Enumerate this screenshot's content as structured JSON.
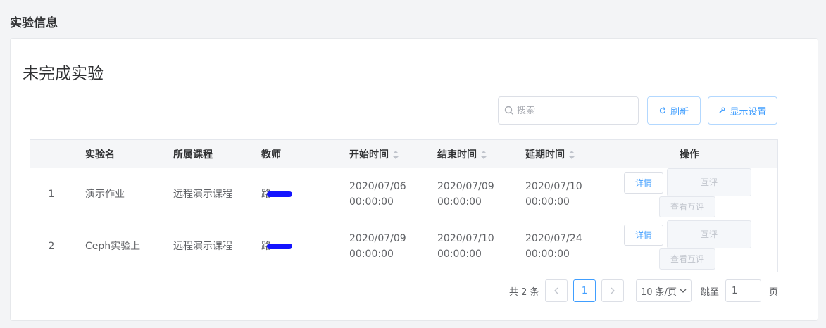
{
  "header": {
    "section_title": "实验信息"
  },
  "card": {
    "title": "未完成实验"
  },
  "toolbar": {
    "search_placeholder": "搜索",
    "refresh_label": "刷新",
    "settings_label": "显示设置"
  },
  "table": {
    "columns": [
      "",
      "实验名",
      "所属课程",
      "教师",
      "开始时间",
      "结束时间",
      "延期时间",
      "操作"
    ],
    "rows": [
      {
        "idx": "1",
        "name": "演示作业",
        "course": "远程演示课程",
        "teacher": "路",
        "start": "2020/07/06 00:00:00",
        "end": "2020/07/09 00:00:00",
        "delay": "2020/07/10 00:00:00"
      },
      {
        "idx": "2",
        "name": "Ceph实验上",
        "course": "远程演示课程",
        "teacher": "路",
        "start": "2020/07/09 00:00:00",
        "end": "2020/07/10 00:00:00",
        "delay": "2020/07/24 00:00:00"
      }
    ],
    "ops": {
      "detail": "详情",
      "review": "互评",
      "view_review": "查看互评"
    }
  },
  "pagination": {
    "total_text": "共 2 条",
    "current_page": "1",
    "page_size": "10 条/页",
    "goto_label": "跳至",
    "goto_value": "1",
    "page_unit": "页"
  },
  "colors": {
    "primary": "#409eff",
    "redaction": "#1414ff"
  }
}
